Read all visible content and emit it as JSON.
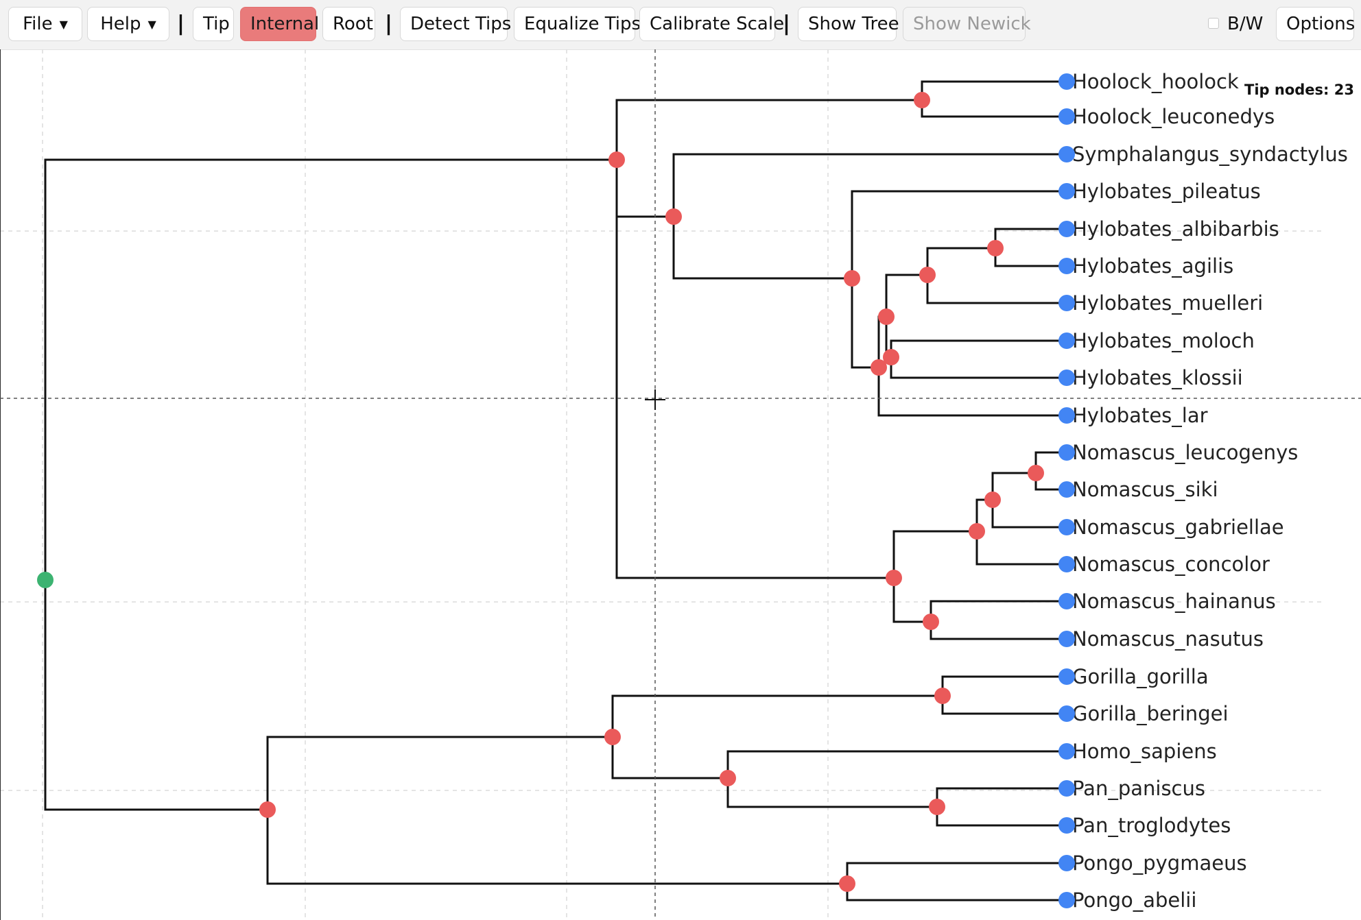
{
  "toolbar": {
    "file_label": "File",
    "help_label": "Help",
    "separator": "|",
    "tip_label": "Tip",
    "internal_label": "Internal",
    "root_label": "Root",
    "detect_tips_label": "Detect Tips",
    "equalize_tips_label": "Equalize Tips",
    "calibrate_scale_label": "Calibrate Scale",
    "show_tree_label": "Show Tree",
    "show_newick_label": "Show Newick",
    "bw_label": "B/W",
    "bw_checked": false,
    "options_label": "Options",
    "active_mode": "Internal"
  },
  "status": {
    "tip_nodes": "Tip nodes: 23"
  },
  "colors": {
    "active_mode": "#e97b7b",
    "tip_node": "#4285f4",
    "internal_node": "#ea5a5a",
    "root_node": "#3cb371",
    "branch": "#111111"
  },
  "tree": {
    "tips": [
      "Hoolock_hoolock",
      "Hoolock_leuconedys",
      "Symphalangus_syndactylus",
      "Hylobates_pileatus",
      "Hylobates_albibarbis",
      "Hylobates_agilis",
      "Hylobates_muelleri",
      "Hylobates_moloch",
      "Hylobates_klossii",
      "Hylobates_lar",
      "Nomascus_leucogenys",
      "Nomascus_siki",
      "Nomascus_gabriellae",
      "Nomascus_concolor",
      "Nomascus_hainanus",
      "Nomascus_nasutus",
      "Gorilla_gorilla",
      "Gorilla_beringei",
      "Homo_sapiens",
      "Pan_paniscus",
      "Pan_troglodytes",
      "Pongo_pygmaeus",
      "Pongo_abelii"
    ]
  }
}
